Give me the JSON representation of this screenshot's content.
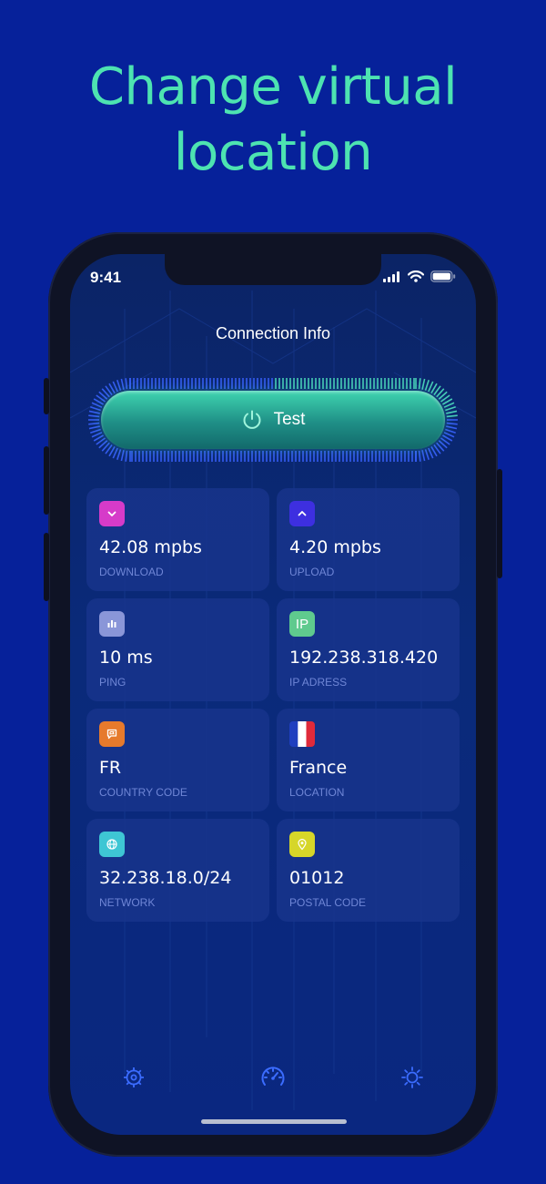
{
  "headline": {
    "line1": "Change virtual",
    "line2": "location"
  },
  "status_bar": {
    "time": "9:41"
  },
  "screen": {
    "title": "Connection Info",
    "test_button_label": "Test"
  },
  "cards": [
    {
      "value": "42.08 mpbs",
      "label": "DOWNLOAD",
      "icon": "chevron-down-icon",
      "color": "#d63bc9"
    },
    {
      "value": "4.20 mpbs",
      "label": "UPLOAD",
      "icon": "chevron-up-icon",
      "color": "#3d2fe0"
    },
    {
      "value": "10 ms",
      "label": "PING",
      "icon": "bar-chart-icon",
      "color": "#8a96d8"
    },
    {
      "value": "192.238.318.420",
      "label": "IP ADRESS",
      "icon": "ip-badge-icon",
      "icon_text": "IP",
      "color": "#5fca8e"
    },
    {
      "value": "FR",
      "label": "COUNTRY CODE",
      "icon": "chat-flag-icon",
      "color": "#e67a2c"
    },
    {
      "value": "France",
      "label": "LOCATION",
      "icon": "france-flag-icon",
      "color": "#ffffff"
    },
    {
      "value": "32.238.18.0/24",
      "label": "NETWORK",
      "icon": "globe-icon",
      "color": "#3ec6d4"
    },
    {
      "value": "01012",
      "label": "POSTAL CODE",
      "icon": "location-pin-icon",
      "color": "#d6d629"
    }
  ],
  "tabs": [
    {
      "name": "vpn-tab",
      "icon": "atom-gear-icon",
      "active": false
    },
    {
      "name": "speed-test-tab",
      "icon": "speedometer-icon",
      "active": true
    },
    {
      "name": "settings-tab",
      "icon": "sun-gear-icon",
      "active": false
    }
  ],
  "colors": {
    "background": "#06219a",
    "headline": "#4de3b1",
    "accent_teal": "#3fd4b0",
    "card_label": "#6f86d6",
    "tab_icon": "#3b6cff"
  }
}
